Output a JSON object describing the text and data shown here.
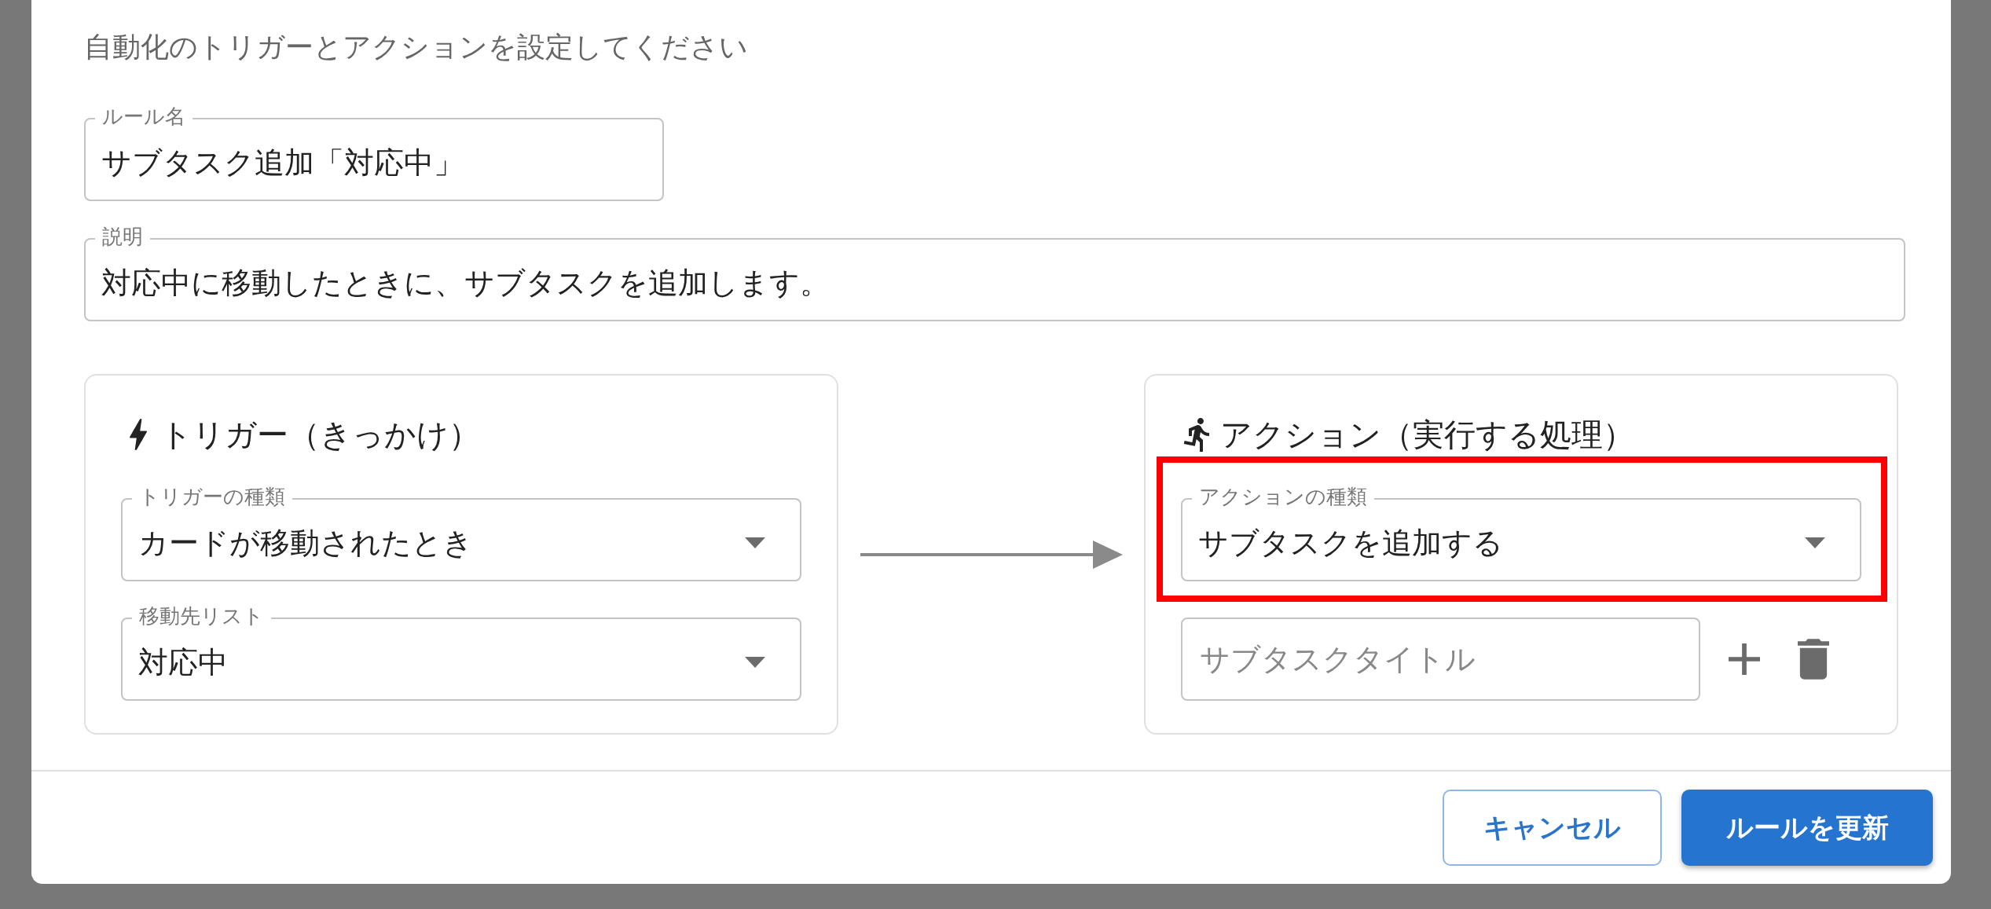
{
  "dialog": {
    "subtitle": "自動化のトリガーとアクションを設定してください",
    "fields": [
      {
        "kind": "text",
        "label": "ルール名",
        "value": "サブタスク追加「対応中」",
        "wide": false
      },
      {
        "kind": "text",
        "label": "説明",
        "value": "対応中に移動したときに、サブタスクを追加します。",
        "wide": true
      }
    ],
    "cards": [
      {
        "kind": "trigger",
        "title": "トリガー（きっかけ）",
        "fields": [
          {
            "kind": "select",
            "label": "トリガーの種類",
            "value": "カードが移動されたとき",
            "highlighted": false
          },
          {
            "kind": "select",
            "label": "移動先リスト",
            "value": "対応中",
            "highlighted": false
          }
        ]
      },
      {
        "kind": "action",
        "title": "アクション（実行する処理）",
        "fields": [
          {
            "kind": "select",
            "label": "アクションの種類",
            "value": "サブタスクを追加する",
            "highlighted": true
          },
          {
            "kind": "subtask",
            "placeholder": "サブタスクタイトル"
          }
        ]
      }
    ],
    "buttons": [
      {
        "kind": "secondary",
        "label": "キャンセル"
      },
      {
        "kind": "primary",
        "label": "ルールを更新"
      }
    ]
  }
}
